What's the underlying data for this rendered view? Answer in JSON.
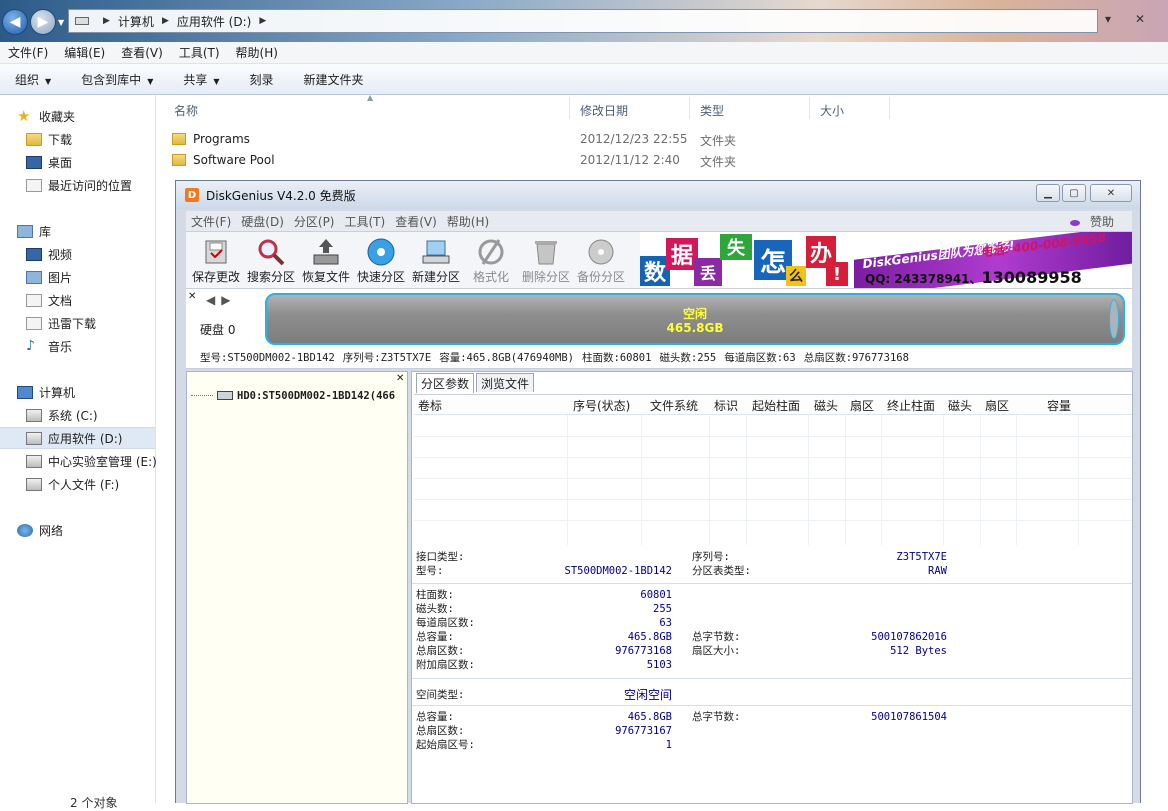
{
  "explorer": {
    "breadcrumb": [
      "计算机",
      "应用软件 (D:)"
    ],
    "menu": [
      "文件(F)",
      "编辑(E)",
      "查看(V)",
      "工具(T)",
      "帮助(H)"
    ],
    "commands": {
      "organize": "组织",
      "include_library": "包含到库中",
      "share": "共享",
      "burn": "刻录",
      "new_folder": "新建文件夹"
    },
    "sidebar": {
      "favorites": "收藏夹",
      "favorite_items": [
        "下载",
        "桌面",
        "最近访问的位置"
      ],
      "libraries": "库",
      "library_items": [
        "视频",
        "图片",
        "文档",
        "迅雷下载",
        "音乐"
      ],
      "computer": "计算机",
      "drives": [
        "系统 (C:)",
        "应用软件 (D:)",
        "中心实验室管理 (E:)",
        "个人文件 (F:)"
      ],
      "network": "网络"
    },
    "columns": {
      "name": "名称",
      "date": "修改日期",
      "type": "类型",
      "size": "大小"
    },
    "files": [
      {
        "name": "Programs",
        "date": "2012/12/23 22:55",
        "type": "文件夹"
      },
      {
        "name": "Software Pool",
        "date": "2012/11/12 2:40",
        "type": "文件夹"
      }
    ],
    "status": "2 个对象"
  },
  "diskgenius": {
    "title": "DiskGenius V4.2.0 免费版",
    "menu": [
      "文件(F)",
      "硬盘(D)",
      "分区(P)",
      "工具(T)",
      "查看(V)",
      "帮助(H)"
    ],
    "donate": "赞助",
    "toolbar": [
      "保存更改",
      "搜索分区",
      "恢复文件",
      "快速分区",
      "新建分区",
      "格式化",
      "删除分区",
      "备份分区"
    ],
    "banner": {
      "chars": [
        "数",
        "据",
        "丢",
        "失",
        "怎",
        "么",
        "办",
        "!"
      ],
      "team": "DiskGenius团队为您服务!",
      "tel": "电话: 400-008-9958",
      "qq_label": "QQ: 243378941、",
      "qq_big": "13008",
      "qq_big2": "9958"
    },
    "disk": {
      "label": "硬盘 0",
      "space_label": "空闲",
      "space_size": "465.8GB",
      "model": "型号:ST500DM002-1BD142",
      "serial": "序列号:Z3T5TX7E",
      "capacity": "容量:465.8GB(476940MB)",
      "cylinders": "柱面数:60801",
      "heads": "磁头数:255",
      "sectors_per_track": "每道扇区数:63",
      "total_sectors": "总扇区数:976773168"
    },
    "tree_item": "HD0:ST500DM002-1BD142(466",
    "tabs": [
      "分区参数",
      "浏览文件"
    ],
    "table_headers": [
      "卷标",
      "序号(状态)",
      "文件系统",
      "标识",
      "起始柱面",
      "磁头",
      "扇区",
      "终止柱面",
      "磁头",
      "扇区",
      "容量"
    ],
    "details": {
      "interface_label": "接口类型:",
      "model_label": "型号:",
      "model_value": "ST500DM002-1BD142",
      "serial_label": "序列号:",
      "serial_value": "Z3T5TX7E",
      "pt_label": "分区表类型:",
      "pt_value": "RAW",
      "cyl_label": "柱面数:",
      "cyl_value": "60801",
      "heads_label": "磁头数:",
      "heads_value": "255",
      "spt_label": "每道扇区数:",
      "spt_value": "63",
      "total_cap_label": "总容量:",
      "total_cap_value": "465.8GB",
      "total_bytes_label": "总字节数:",
      "total_bytes_value": "500107862016",
      "total_sect_label": "总扇区数:",
      "total_sect_value": "976773168",
      "sector_size_label": "扇区大小:",
      "sector_size_value": "512 Bytes",
      "extra_sect_label": "附加扇区数:",
      "extra_sect_value": "5103",
      "space_type_label": "空间类型:",
      "space_type_value": "空闲空间",
      "s_total_cap_label": "总容量:",
      "s_total_cap_value": "465.8GB",
      "s_total_bytes_label": "总字节数:",
      "s_total_bytes_value": "500107861504",
      "s_total_sect_label": "总扇区数:",
      "s_total_sect_value": "976773167",
      "s_start_sect_label": "起始扇区号:",
      "s_start_sect_value": "1"
    }
  }
}
